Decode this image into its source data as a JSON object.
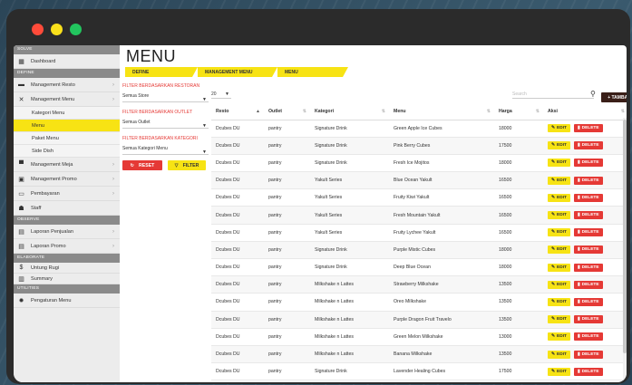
{
  "window": {
    "dots": [
      "#ff4b3a",
      "#f9e01b",
      "#22c55e"
    ]
  },
  "sidebar": {
    "sections": [
      {
        "label": "SOLVE"
      },
      {
        "label": "DEFINE"
      },
      {
        "label": "OBSERVE"
      },
      {
        "label": "ELABORATE"
      },
      {
        "label": "UTILITIES"
      }
    ],
    "dashboard": "Dashboard",
    "management_resto": "Management Resto",
    "management_menu": "Management Menu",
    "sub_menu": [
      "Kategori Menu",
      "Menu",
      "Paket Menu",
      "Side Dish"
    ],
    "management_meja": "Management Meja",
    "management_promo": "Management Promo",
    "pembayaran": "Pembayaran",
    "staff": "Staff",
    "laporan_penjualan": "Laporan Penjualan",
    "laporan_promo": "Laporan Promo",
    "untung_rugi": "Untung Rugi",
    "summary": "Summary",
    "pengaturan_menu": "Pengaturan Menu"
  },
  "page": {
    "title": "MENU",
    "breadcrumbs": [
      "DEFINE",
      "MANAGEMENT MENU",
      "MENU"
    ]
  },
  "filters": {
    "resto_label": "FILTER BERDASARKAN RESTORAN",
    "resto_value": "Semua Store",
    "outlet_label": "FILTER BERDASARKAN OUTLET",
    "outlet_value": "Semua Outlet",
    "kategori_label": "FILTER BERDASARKAN KATEGORI",
    "kategori_value": "Semua Kategori Menu",
    "reset": "RESET",
    "filter": "FILTER"
  },
  "toolbar": {
    "page_size": "20",
    "search_placeholder": "Search",
    "add": "+ TAMBAH"
  },
  "table": {
    "headers": [
      "Resto",
      "Outlet",
      "Kategori",
      "Menu",
      "Harga",
      "Aksi"
    ],
    "edit": "EDIT",
    "delete": "DELETE",
    "rows": [
      [
        "Dcubes DU",
        "pantry",
        "Signature Drink",
        "Green Apple Ice Cubes",
        "18000"
      ],
      [
        "Dcubes DU",
        "pantry",
        "Signature Drink",
        "Pink Berry Cubes",
        "17500"
      ],
      [
        "Dcubes DU",
        "pantry",
        "Signature Drink",
        "Fresh Ice Mojitos",
        "18000"
      ],
      [
        "Dcubes DU",
        "pantry",
        "Yakult Series",
        "Blue Ocean Yakult",
        "16500"
      ],
      [
        "Dcubes DU",
        "pantry",
        "Yakult Series",
        "Fruity Kiwi Yakult",
        "16500"
      ],
      [
        "Dcubes DU",
        "pantry",
        "Yakult Series",
        "Fresh Mountain Yakult",
        "16500"
      ],
      [
        "Dcubes DU",
        "pantry",
        "Yakult Series",
        "Fruity Lychee Yakult",
        "16500"
      ],
      [
        "Dcubes DU",
        "pantry",
        "Signature Drink",
        "Purple Mistic Cubes",
        "18000"
      ],
      [
        "Dcubes DU",
        "pantry",
        "Signature Drink",
        "Deep Blue Ocean",
        "18000"
      ],
      [
        "Dcubes DU",
        "pantry",
        "Milkshake n Lattes",
        "Strawberry Milkshake",
        "13500"
      ],
      [
        "Dcubes DU",
        "pantry",
        "Milkshake n Lattes",
        "Oreo Milkshake",
        "13500"
      ],
      [
        "Dcubes DU",
        "pantry",
        "Milkshake n Lattes",
        "Purple Dragon Fruit Travelo",
        "13500"
      ],
      [
        "Dcubes DU",
        "pantry",
        "Milkshake n Lattes",
        "Green Melon Milkshake",
        "13000"
      ],
      [
        "Dcubes DU",
        "pantry",
        "Milkshake n Lattes",
        "Banana Milkshake",
        "13500"
      ],
      [
        "Dcubes DU",
        "pantry",
        "Signature Drink",
        "Lavender Healing Cubes",
        "17500"
      ]
    ]
  }
}
